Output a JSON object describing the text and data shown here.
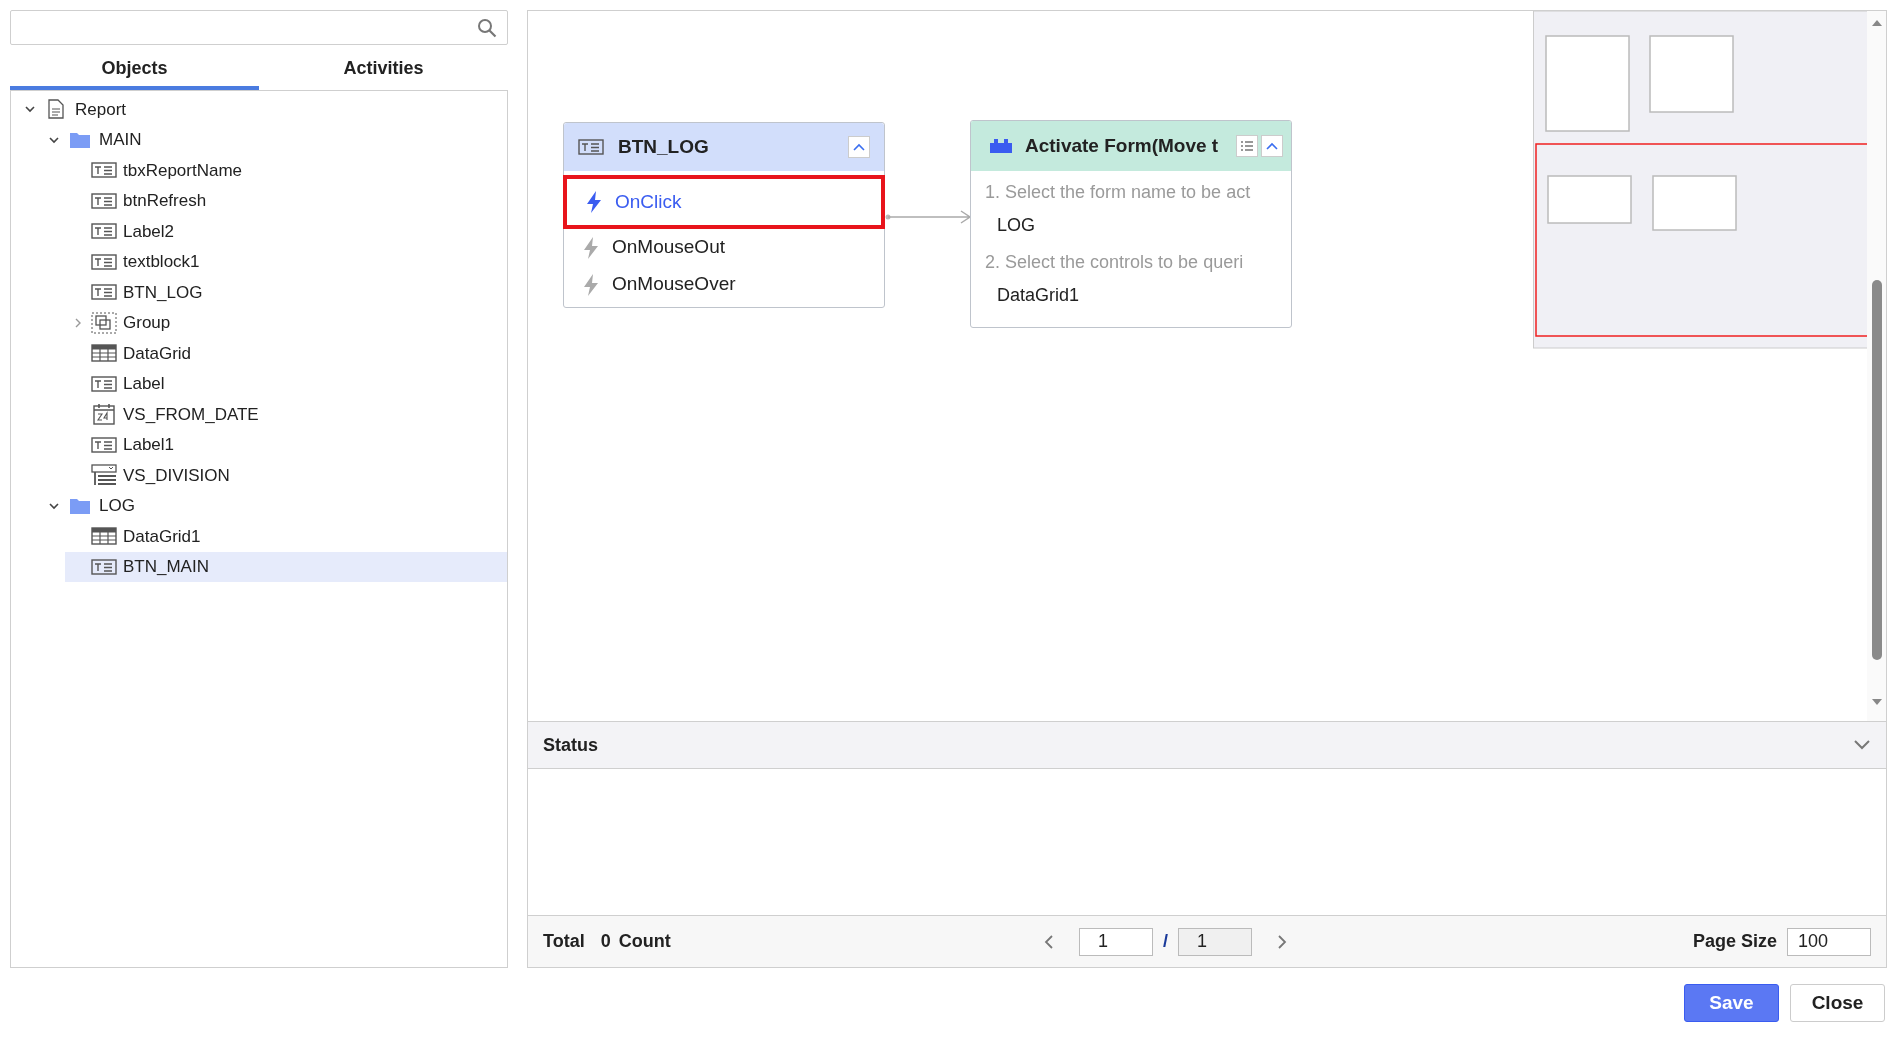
{
  "tabs": [
    {
      "label": "Objects",
      "selected": true
    },
    {
      "label": "Activities",
      "selected": false
    }
  ],
  "tree": [
    {
      "label": "Report",
      "kind": "document",
      "expanded": true,
      "selected": false,
      "children": [
        {
          "label": "MAIN",
          "kind": "folder",
          "expanded": true,
          "selected": false,
          "children": [
            {
              "label": "tbxReportName",
              "kind": "text",
              "selected": false
            },
            {
              "label": "btnRefresh",
              "kind": "text",
              "selected": false
            },
            {
              "label": "Label2",
              "kind": "text",
              "selected": false
            },
            {
              "label": "textblock1",
              "kind": "text",
              "selected": false
            },
            {
              "label": "BTN_LOG",
              "kind": "text",
              "selected": false
            },
            {
              "label": "Group",
              "kind": "group",
              "expanded": false,
              "selected": false
            },
            {
              "label": "DataGrid",
              "kind": "grid",
              "selected": false
            },
            {
              "label": "Label",
              "kind": "text",
              "selected": false
            },
            {
              "label": "VS_FROM_DATE",
              "kind": "calendar",
              "selected": false
            },
            {
              "label": "Label1",
              "kind": "text",
              "selected": false
            },
            {
              "label": "VS_DIVISION",
              "kind": "combo",
              "selected": false
            }
          ]
        },
        {
          "label": "LOG",
          "kind": "folder",
          "expanded": true,
          "selected": false,
          "children": [
            {
              "label": "DataGrid1",
              "kind": "grid",
              "selected": false
            },
            {
              "label": "BTN_MAIN",
              "kind": "text",
              "selected": true
            }
          ]
        }
      ]
    }
  ],
  "event_node": {
    "title": "BTN_LOG",
    "events": [
      {
        "label": "OnClick",
        "selected": true
      },
      {
        "label": "OnMouseOut",
        "selected": false
      },
      {
        "label": "OnMouseOver",
        "selected": false
      }
    ]
  },
  "activity_node": {
    "title": "Activate Form(Move t",
    "steps": [
      {
        "label": "1. Select the form name to be act",
        "value": "LOG"
      },
      {
        "label": "2. Select the controls to be queri",
        "value": "DataGrid1"
      }
    ]
  },
  "status": {
    "title": "Status",
    "expanded": true
  },
  "footer": {
    "total_label": "Total",
    "count": "0",
    "count_label": "Count",
    "page": "1",
    "separator": "/",
    "page_total": "1",
    "page_size_label": "Page Size",
    "page_size": "100"
  },
  "buttons": [
    {
      "label": "Save",
      "kind": "primary"
    },
    {
      "label": "Close",
      "kind": "secondary"
    }
  ]
}
